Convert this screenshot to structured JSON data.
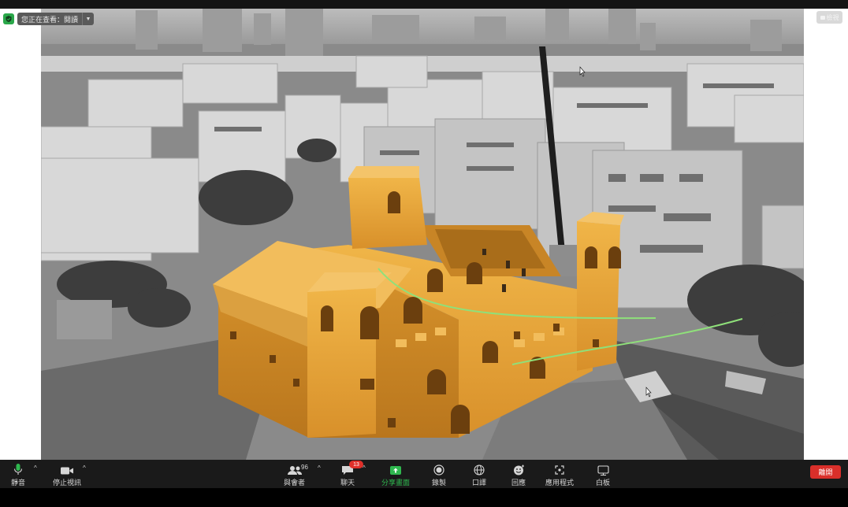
{
  "top_bar": {
    "security_icon": "shield-check-icon",
    "viewing_label": "您正在查看：閱讀",
    "view_button_label": "檢視"
  },
  "toolbar": {
    "mute_label": "靜音",
    "stop_video_label": "停止視訊",
    "participants_label": "與會者",
    "participants_count": "96",
    "chat_label": "聊天",
    "chat_badge": "13",
    "share_label": "分享畫面",
    "record_label": "錄製",
    "interpretation_label": "口譯",
    "reactions_label": "回應",
    "apps_label": "應用程式",
    "whiteboard_label": "白板",
    "end_label": "離開"
  },
  "colors": {
    "toolbar_bg": "#1a1a1a",
    "share_green": "#2fb84f",
    "end_red": "#d92f2a",
    "badge_red": "#e0302a",
    "annotation_green": "#8fe07a",
    "timber": "#e6a436"
  }
}
